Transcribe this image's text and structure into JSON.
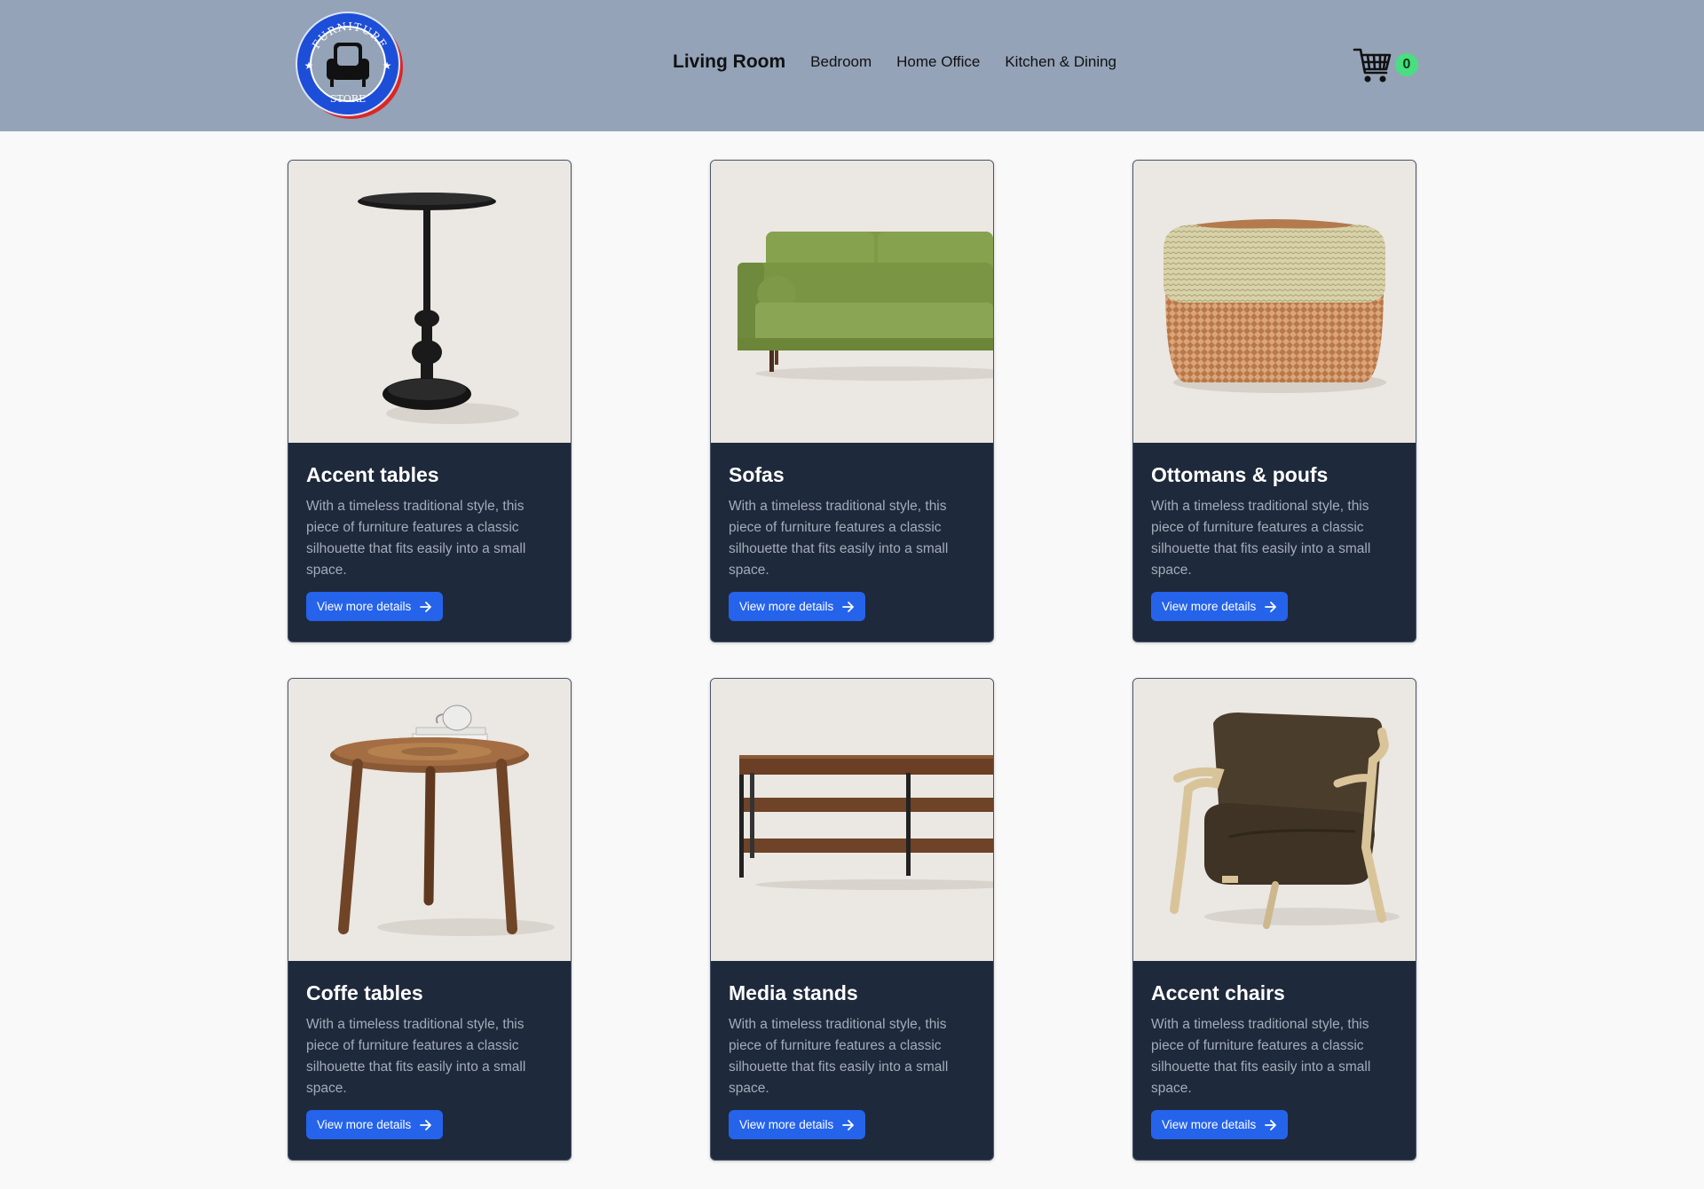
{
  "header": {
    "logo": {
      "top_text": "FURNITURE",
      "bottom_text": "STORE"
    },
    "nav": [
      {
        "label": "Living Room",
        "active": true
      },
      {
        "label": "Bedroom",
        "active": false
      },
      {
        "label": "Home Office",
        "active": false
      },
      {
        "label": "Kitchen & Dining",
        "active": false
      }
    ],
    "cart": {
      "count": "0",
      "icon": "shopping-cart-icon"
    }
  },
  "products": [
    {
      "title": "Accent tables",
      "description": "With a timeless traditional style, this piece of furniture features a classic silhouette that fits easily into a small space.",
      "button_label": "View more details"
    },
    {
      "title": "Sofas",
      "description": "With a timeless traditional style, this piece of furniture features a classic silhouette that fits easily into a small space.",
      "button_label": "View more details"
    },
    {
      "title": "Ottomans & poufs",
      "description": "With a timeless traditional style, this piece of furniture features a classic silhouette that fits easily into a small space.",
      "button_label": "View more details"
    },
    {
      "title": "Coffe tables",
      "description": "With a timeless traditional style, this piece of furniture features a classic silhouette that fits easily into a small space.",
      "button_label": "View more details"
    },
    {
      "title": "Media stands",
      "description": "With a timeless traditional style, this piece of furniture features a classic silhouette that fits easily into a small space.",
      "button_label": "View more details"
    },
    {
      "title": "Accent chairs",
      "description": "With a timeless traditional style, this piece of furniture features a classic silhouette that fits easily into a small space.",
      "button_label": "View more details"
    }
  ],
  "colors": {
    "header_bg": "#94a3b8",
    "card_bg": "#1e293b",
    "button_bg": "#2563eb",
    "badge_bg": "#4ade80",
    "page_bg": "#f9f9f9"
  }
}
